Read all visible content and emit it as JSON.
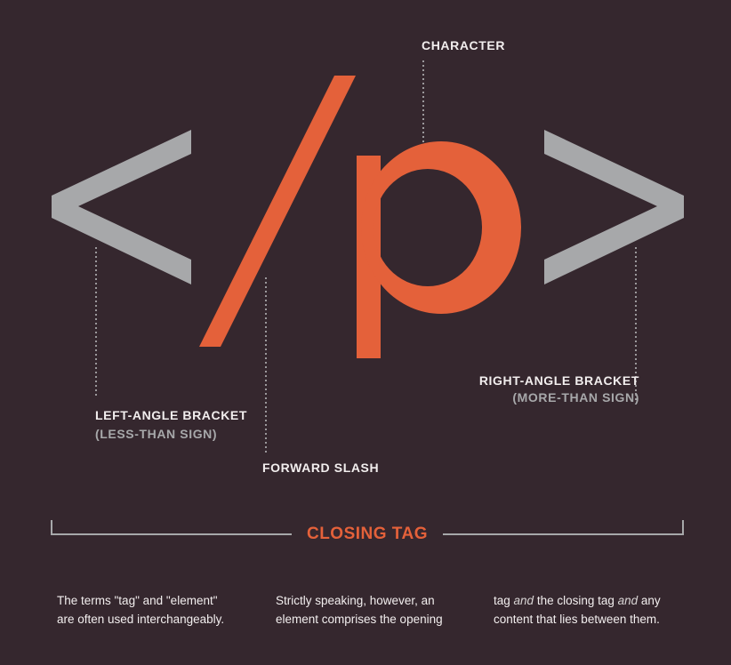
{
  "colors": {
    "background": "#35272e",
    "bracket": "#a7a8aa",
    "accent": "#e4613a"
  },
  "glyphs": {
    "left_bracket": "<",
    "slash": "/",
    "character": "p",
    "right_bracket": ">"
  },
  "labels": {
    "character": "CHARACTER",
    "left_bracket": "LEFT-ANGLE BRACKET",
    "left_bracket_sub": "(LESS-THAN SIGN)",
    "forward_slash": "FORWARD SLASH",
    "right_bracket": "RIGHT-ANGLE BRACKET",
    "right_bracket_sub": "(MORE-THAN SIGN)"
  },
  "closing_tag": "CLOSING TAG",
  "columns": [
    {
      "line1": "The terms \"tag\" and \"element\"",
      "line2": "are often used interchangeably."
    },
    {
      "line1": "Strictly speaking, however, an",
      "line2": "element comprises the opening"
    },
    {
      "line1_a": "tag ",
      "line1_b": "and",
      "line1_c": " the closing tag ",
      "line1_d": "and",
      "line1_e": " any",
      "line2": "content that lies between them."
    }
  ]
}
